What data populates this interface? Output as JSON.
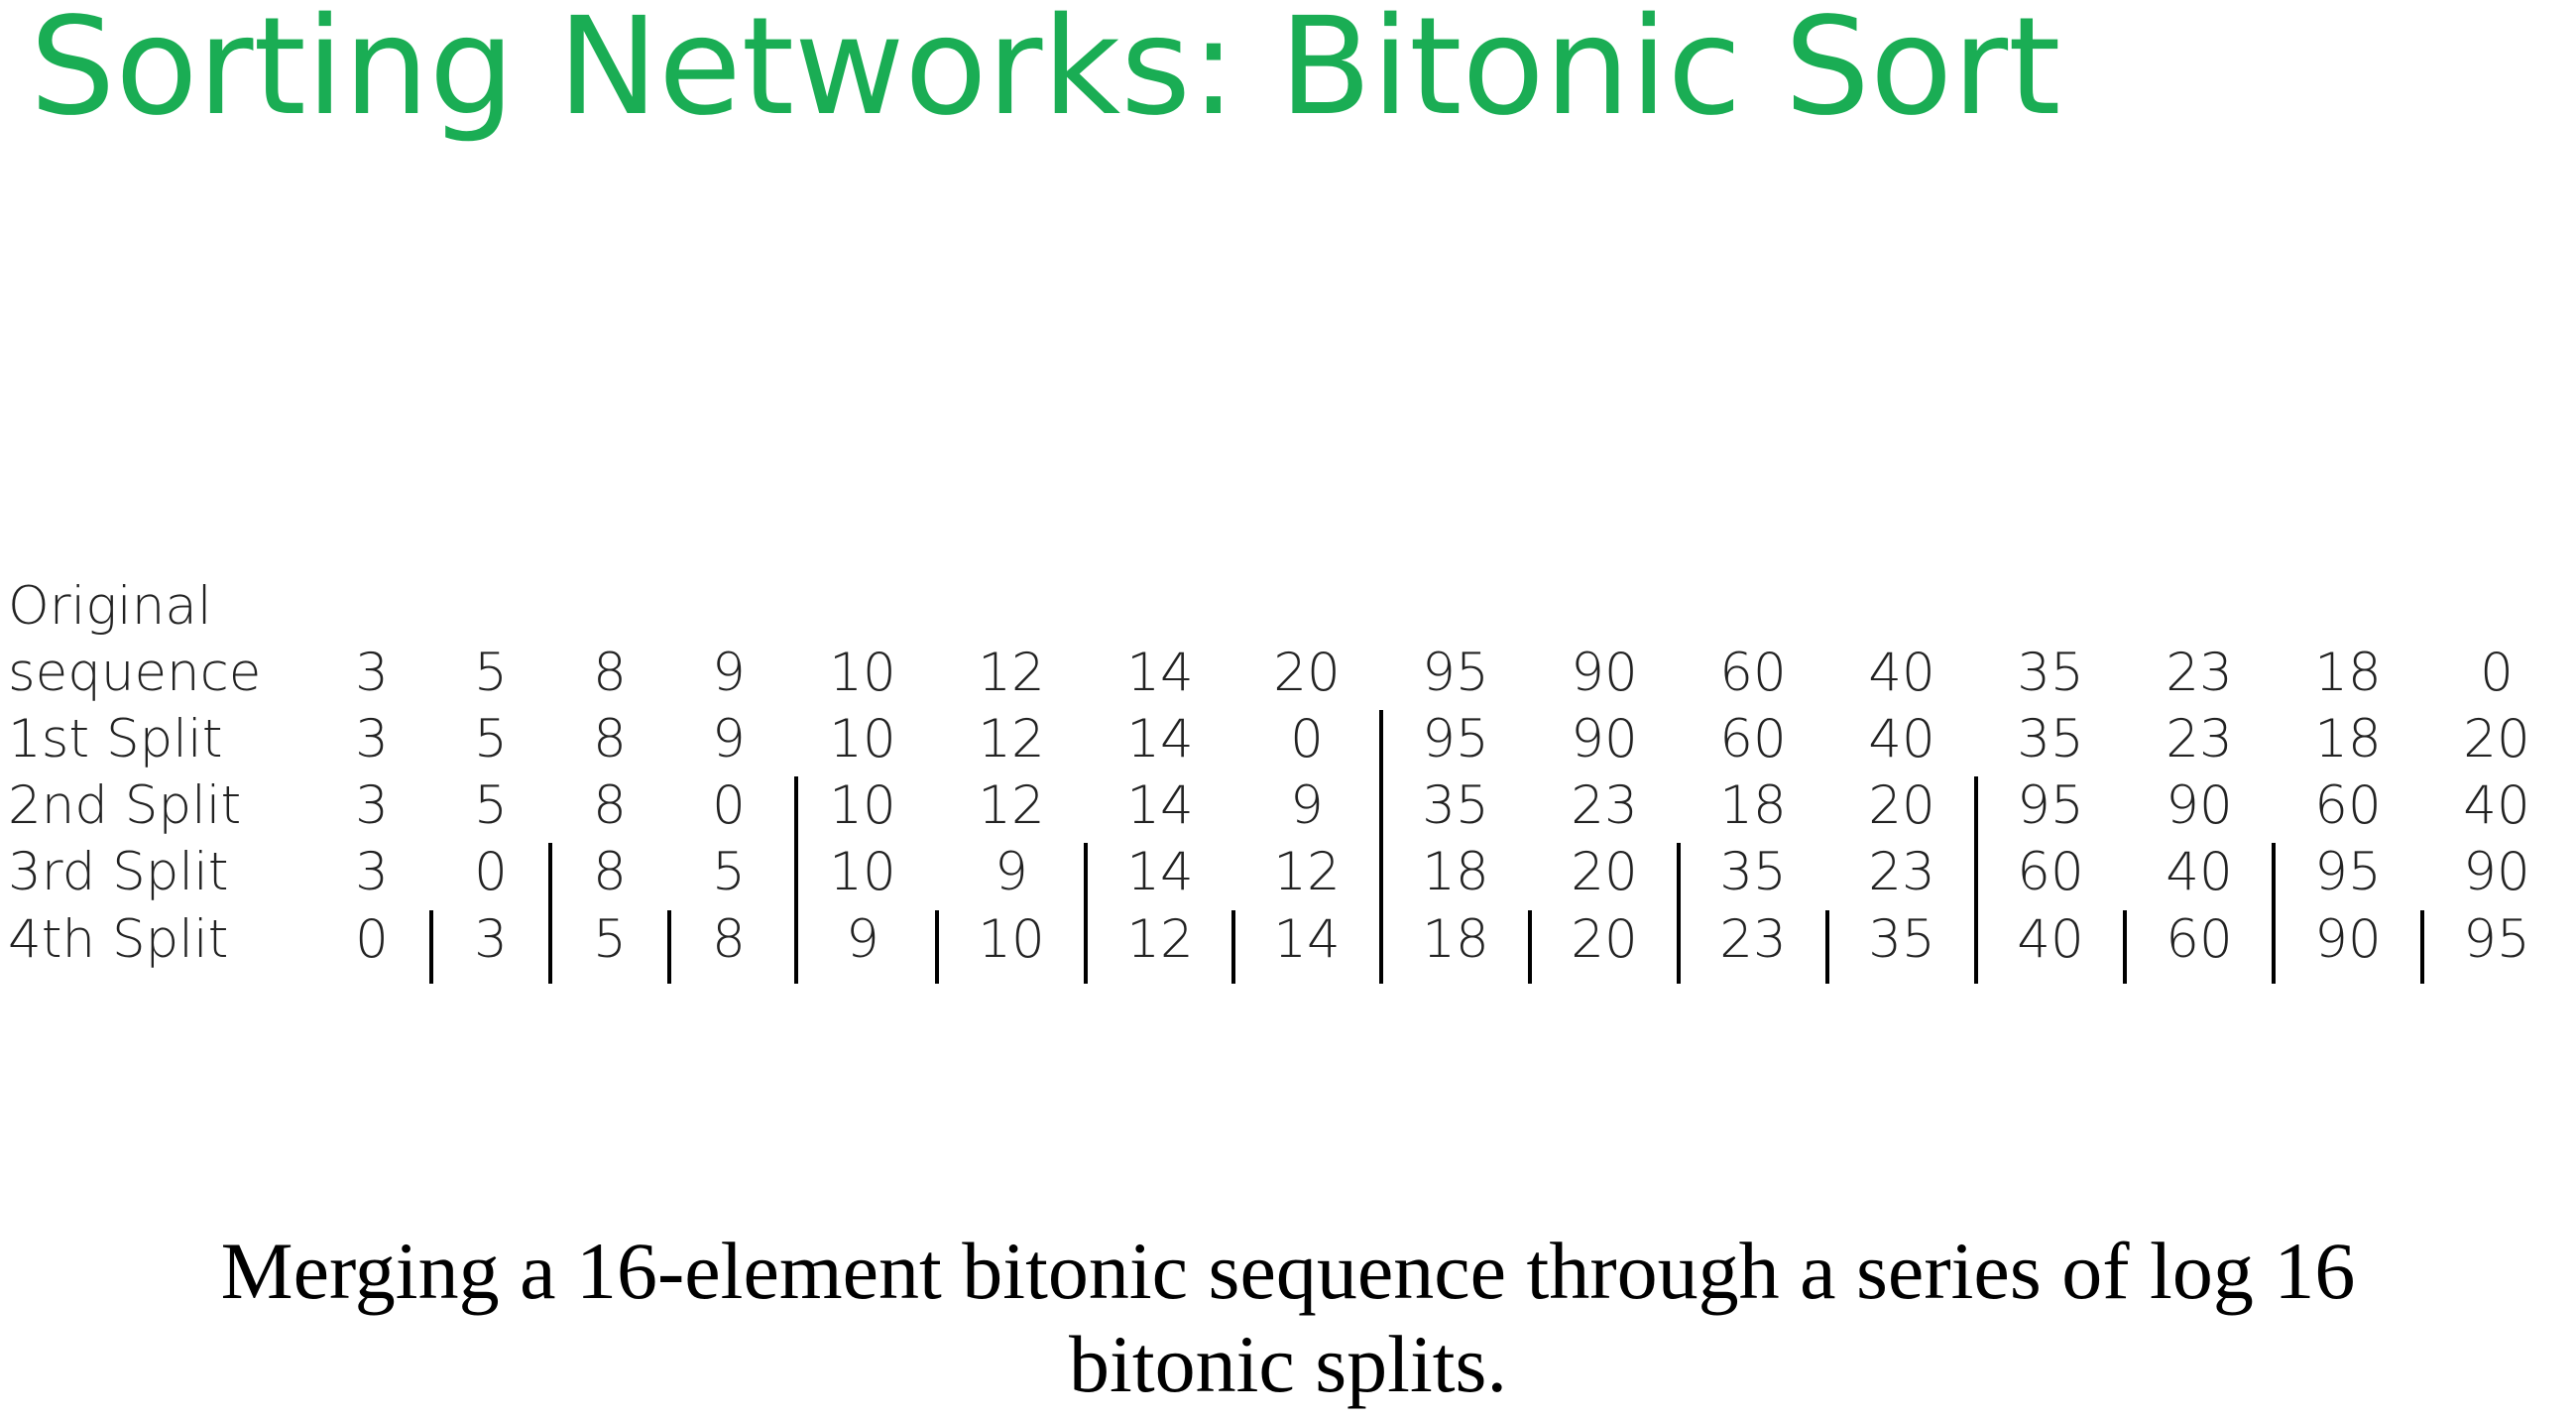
{
  "title": "Sorting Networks: Bitonic Sort",
  "row_labels": [
    "Original",
    "sequence",
    "1st Split",
    "2nd Split",
    "3rd Split",
    "4th Split"
  ],
  "rows": [
    [
      "3",
      "5",
      "8",
      "9",
      "10",
      "12",
      "14",
      "20",
      "95",
      "90",
      "60",
      "40",
      "35",
      "23",
      "18",
      "0"
    ],
    [
      "3",
      "5",
      "8",
      "9",
      "10",
      "12",
      "14",
      "0",
      "95",
      "90",
      "60",
      "40",
      "35",
      "23",
      "18",
      "20"
    ],
    [
      "3",
      "5",
      "8",
      "0",
      "10",
      "12",
      "14",
      "9",
      "35",
      "23",
      "18",
      "20",
      "95",
      "90",
      "60",
      "40"
    ],
    [
      "3",
      "0",
      "8",
      "5",
      "10",
      "9",
      "14",
      "12",
      "18",
      "20",
      "35",
      "23",
      "60",
      "40",
      "95",
      "90"
    ],
    [
      "0",
      "3",
      "5",
      "8",
      "9",
      "10",
      "12",
      "14",
      "18",
      "20",
      "23",
      "35",
      "40",
      "60",
      "90",
      "95"
    ]
  ],
  "caption": {
    "line1": "Merging a 16-element bitonic sequence through a series of log 16",
    "line2": "bitonic splits."
  }
}
